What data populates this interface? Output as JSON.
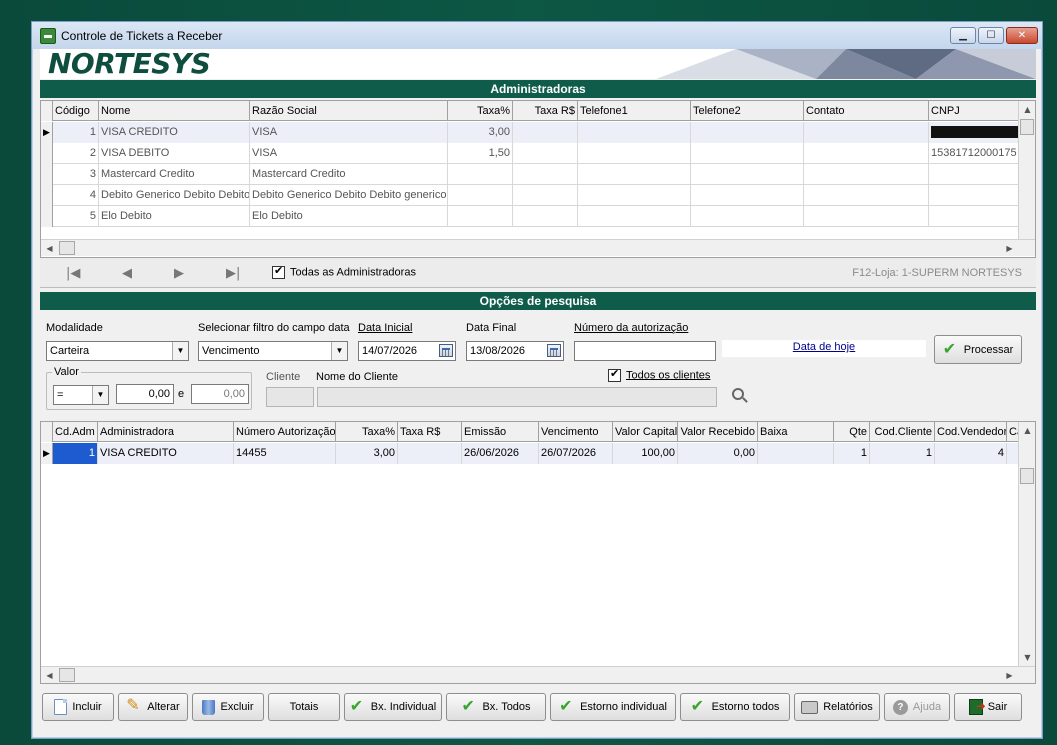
{
  "window": {
    "title": "Controle de Tickets a Receber",
    "logo": "NORTESYS"
  },
  "admins": {
    "section_title": "Administradoras",
    "columns": [
      "Código",
      "Nome",
      "Razão Social",
      "Taxa%",
      "Taxa R$",
      "Telefone1",
      "Telefone2",
      "Contato",
      "CNPJ"
    ],
    "rows": [
      {
        "codigo": "1",
        "nome": "VISA CREDITO",
        "razao": "VISA",
        "taxa_pct": "3,00",
        "taxa_rs": "",
        "tel1": "",
        "tel2": "",
        "contato": "",
        "cnpj": "[redacted]"
      },
      {
        "codigo": "2",
        "nome": "VISA DEBITO",
        "razao": "VISA",
        "taxa_pct": "1,50",
        "taxa_rs": "",
        "tel1": "",
        "tel2": "",
        "contato": "",
        "cnpj": "15381712000175"
      },
      {
        "codigo": "3",
        "nome": "Mastercard Credito",
        "razao": "Mastercard Credito",
        "taxa_pct": "",
        "taxa_rs": "",
        "tel1": "",
        "tel2": "",
        "contato": "",
        "cnpj": ""
      },
      {
        "codigo": "4",
        "nome": "Debito Generico Debito Debito g",
        "razao": "Debito Generico Debito Debito generico",
        "taxa_pct": "",
        "taxa_rs": "",
        "tel1": "",
        "tel2": "",
        "contato": "",
        "cnpj": ""
      },
      {
        "codigo": "5",
        "nome": "Elo Debito",
        "razao": "Elo Debito",
        "taxa_pct": "",
        "taxa_rs": "",
        "tel1": "",
        "tel2": "",
        "contato": "",
        "cnpj": ""
      }
    ],
    "all_checkbox_label": "Todas as Administradoras",
    "all_checked": true,
    "store_info": "F12-Loja: 1-SUPERM NORTESYS"
  },
  "search": {
    "section_title": "Opções de pesquisa",
    "modalidade_label": "Modalidade",
    "modalidade_value": "Carteira",
    "filtro_label": "Selecionar filtro do campo data",
    "filtro_value": "Vencimento",
    "data_inicial_label": "Data Inicial",
    "data_inicial_value": "14/07/2026",
    "data_final_label": "Data Final",
    "data_final_value": "13/08/2026",
    "autorizacao_label": "Número da autorização",
    "autorizacao_value": "",
    "data_hoje_link": "Data de hoje",
    "processar_label": "Processar",
    "valor_label": "Valor",
    "valor_op": "=",
    "valor_de": "0,00",
    "valor_e": "e",
    "valor_ate": "0,00",
    "cliente_label": "Cliente",
    "nome_cliente_label": "Nome do Cliente",
    "todos_clientes_label": "Todos os clientes",
    "todos_clientes_checked": true
  },
  "tickets": {
    "columns": [
      "Cd.Adm",
      "Administradora",
      "Número Autorização",
      "Taxa%",
      "Taxa R$",
      "Emissão",
      "Vencimento",
      "Valor Capital",
      "Valor Recebido",
      "Baixa",
      "Qte",
      "Cod.Cliente",
      "Cod.Vendedor",
      "Ca"
    ],
    "rows": [
      {
        "cd_adm": "1",
        "administradora": "VISA CREDITO",
        "num_aut": "14455",
        "taxa_pct": "3,00",
        "taxa_rs": "",
        "emissao": "26/06/2026",
        "vencimento": "26/07/2026",
        "valor_capital": "100,00",
        "valor_recebido": "0,00",
        "baixa": "",
        "qte": "1",
        "cod_cliente": "1",
        "cod_vendedor": "4",
        "ca": ""
      }
    ]
  },
  "toolbar": {
    "incluir": "Incluir",
    "alterar": "Alterar",
    "excluir": "Excluir",
    "totais": "Totais",
    "bx_individual": "Bx. Individual",
    "bx_todos": "Bx. Todos",
    "estorno_individual": "Estorno individual",
    "estorno_todos": "Estorno todos",
    "relatorios": "Relatórios",
    "ajuda": "Ajuda",
    "sair": "Sair"
  }
}
